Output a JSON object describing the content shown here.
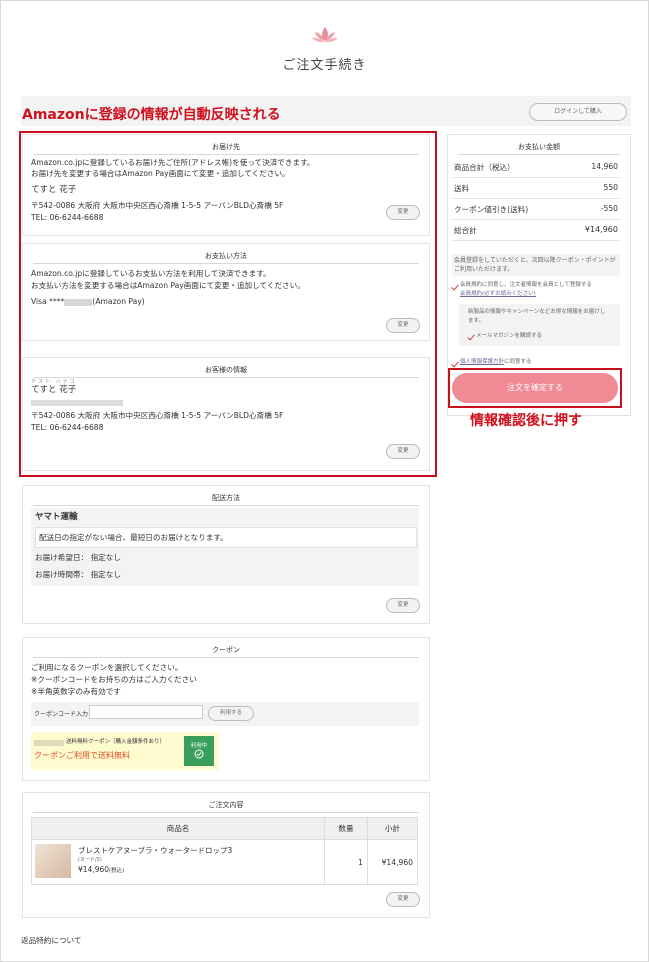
{
  "page": {
    "title": "ご注文手続き"
  },
  "header": {
    "login_button": "ログインして購入"
  },
  "annotations": {
    "auto_reflect": "Amazonに登録の情報が自動反映される",
    "confirm_hint": "情報確認後に押す"
  },
  "delivery_address": {
    "heading": "お届け先",
    "desc1": "Amazon.co.jpに登録しているお届け先ご住所(アドレス帳)を使って決済できます。",
    "desc2": "お届け先を変更する場合はAmazon Pay画面にて変更・追加してください。",
    "name": "てすと 花子",
    "address": "〒542-0086 大阪府 大阪市中央区西心斎橋 1-5-5 アーバンBLD心斎橋 5F",
    "tel": "TEL: 06-6244-6688",
    "change": "変更"
  },
  "payment_method": {
    "heading": "お支払い方法",
    "desc1": "Amazon.co.jpに登録しているお支払い方法を利用して決済できます。",
    "desc2": "お支払い方法を変更する場合はAmazon Pay画面にて変更・追加してください。",
    "card_prefix": "Visa ****",
    "card_suffix": "(Amazon Pay)",
    "change": "変更"
  },
  "customer_info": {
    "heading": "お客様の情報",
    "kana": "テスト ハナコ",
    "name": "てすと 花子",
    "address": "〒542-0086 大阪府 大阪市中央区西心斎橋 1-5-5 アーバンBLD心斎橋 5F",
    "tel": "TEL: 06-6244-6688",
    "change": "変更"
  },
  "shipping": {
    "heading": "配送方法",
    "carrier": "ヤマト運輸",
    "note": "配送日の指定がない場合、最短日のお届けとなります。",
    "date_label": "お届け希望日：",
    "date_value": "指定なし",
    "time_label": "お届け時間帯：",
    "time_value": "指定なし",
    "change": "変更"
  },
  "coupon": {
    "heading": "クーポン",
    "line1": "ご利用になるクーポンを選択してください。",
    "line2": "※クーポンコードをお持ちの方はご入力ください",
    "line3": "※半角英数字のみ有効です",
    "code_label": "クーポンコード入力",
    "code_value": "",
    "apply_button": "利用する",
    "free_coupon_title": "送料無料クーポン（購入金額条件あり）",
    "free_coupon_desc": "クーポンご利用で送料無料",
    "in_use_badge": "利用中"
  },
  "order_contents": {
    "heading": "ご注文内容",
    "columns": [
      "商品名",
      "数量",
      "小計"
    ],
    "items": [
      {
        "name": "ブレストケアヌーブラ・ウォータードロップ3",
        "variant": "(ヌード/3)",
        "price": "¥14,960",
        "tax_note": "(税込)",
        "qty": "1",
        "subtotal": "¥14,960"
      }
    ],
    "change": "変更"
  },
  "payment_summary": {
    "heading": "お支払い金額",
    "rows": [
      {
        "label": "商品合計（税込）",
        "value": "14,960"
      },
      {
        "label": "送料",
        "value": "550"
      },
      {
        "label": "クーポン値引き(送料)",
        "value": "-550"
      },
      {
        "label": "総合計",
        "value": "¥14,960"
      }
    ]
  },
  "membership": {
    "desc": "会員登録をしていただくと、次回以降クーポン・ポイントがご利用いただけます。",
    "agree1": "会員規約に同意し、注文者情報を会員として登録する",
    "terms_link": "会員規約(必ずお読みください)",
    "newsletter_desc1": "新製品の情報やキャンペーンなどお得な情報をお届けし",
    "newsletter_desc2": "ます。",
    "newsletter_check": "メールマガジンを購読する",
    "privacy_link": "個人情報保護方針",
    "privacy_suffix": "に同意する"
  },
  "confirm_button": "注文を確定する",
  "footer": {
    "returns_link": "返品特約について"
  },
  "colors": {
    "accent": "#f08a94",
    "annotation": "#d0101c",
    "coupon_green": "#3a9e5c"
  }
}
